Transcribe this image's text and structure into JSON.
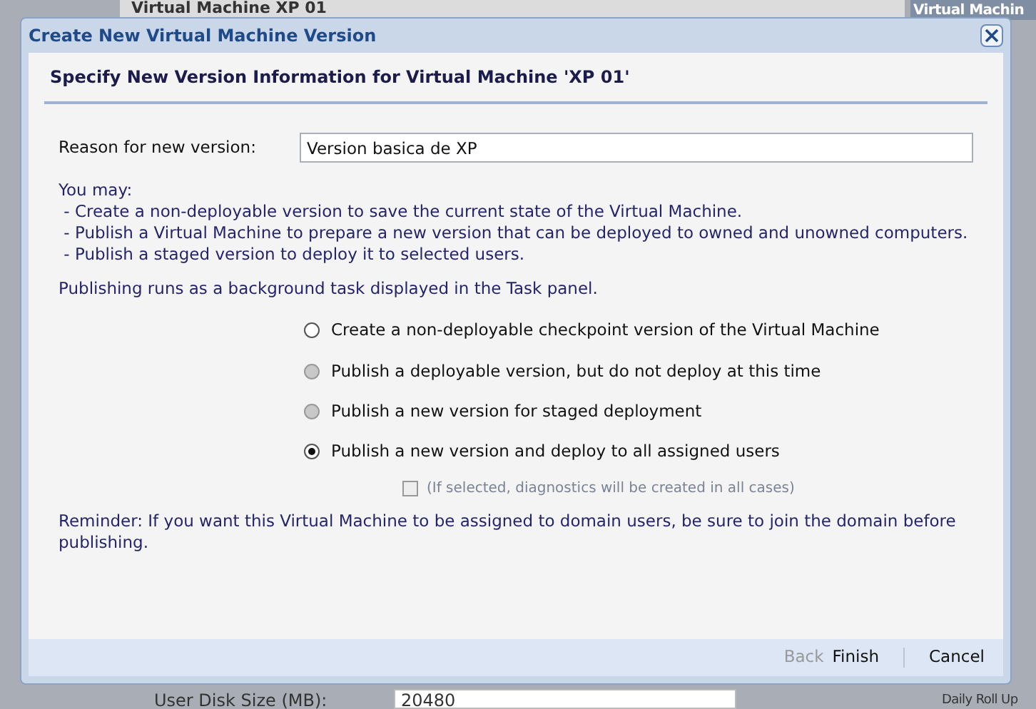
{
  "background": {
    "title": "Virtual Machine XP 01",
    "side_title": "Virtual Machin",
    "disk_label": "User Disk Size (MB):",
    "disk_value": "20480",
    "side_item": "Daily Roll Up"
  },
  "dialog": {
    "title": "Create New Virtual Machine Version",
    "heading": "Specify New Version Information for Virtual Machine 'XP 01'",
    "reason": {
      "label": "Reason for new version:",
      "value": "Version basica de XP"
    },
    "intro": [
      "You may:",
      " - Create a non-deployable version to save the current state of the Virtual Machine.",
      " - Publish a Virtual Machine to prepare a new version that can be deployed to owned and unowned computers.",
      " - Publish a staged version to deploy it to selected users."
    ],
    "note": "Publishing runs as a background task displayed in the Task panel.",
    "options": [
      {
        "label": "Create a non-deployable checkpoint version of the Virtual Machine",
        "selected": false,
        "disabled": false
      },
      {
        "label": "Publish a deployable version, but do not deploy at this time",
        "selected": false,
        "disabled": true
      },
      {
        "label": "Publish a new version for staged deployment",
        "selected": false,
        "disabled": true
      },
      {
        "label": "Publish a new version and deploy to all assigned users",
        "selected": true,
        "disabled": false
      }
    ],
    "diagnostics": {
      "label": "(If selected, diagnostics will be created in all cases)",
      "checked": false,
      "disabled": true
    },
    "reminder": "Reminder: If you want this Virtual Machine to be assigned to domain users, be sure to join the domain before publishing.",
    "buttons": [
      {
        "label": "Back",
        "disabled": true
      },
      {
        "label": "Finish",
        "disabled": false
      },
      {
        "label": "Cancel",
        "disabled": false
      }
    ]
  }
}
